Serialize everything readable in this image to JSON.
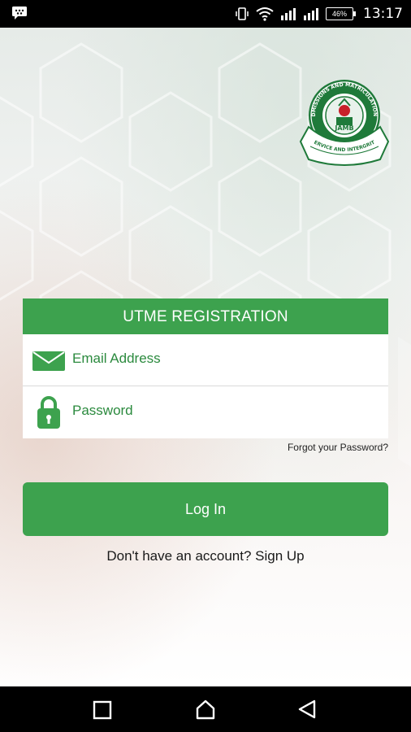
{
  "status_bar": {
    "battery": "46%",
    "time": "13:17"
  },
  "logo": {
    "arc_top": "JOINT ADMISSIONS AND MATRICULATION BOARD",
    "center": "JAMB",
    "ribbon": "SERVICE AND INTERGRITY"
  },
  "card": {
    "title": "UTME REGISTRATION",
    "email_label": "Email Address",
    "password_label": "Password"
  },
  "forgot_password": "Forgot your Password?",
  "login_button": "Log In",
  "signup_text": "Don't have an account? Sign Up",
  "colors": {
    "brand_green": "#3da24e",
    "field_text_green": "#2b8a3e"
  }
}
